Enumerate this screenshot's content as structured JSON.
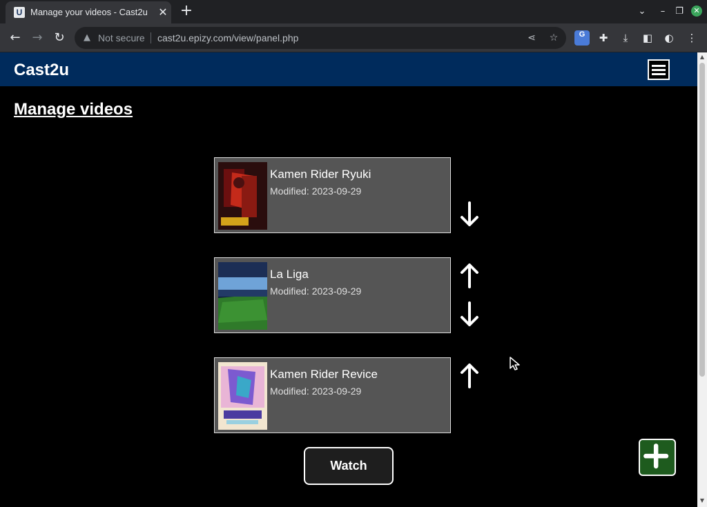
{
  "browser": {
    "tab": {
      "title": "Manage your videos - Cast2u",
      "favicon_letter": "U"
    },
    "new_tab_symbol": "+",
    "omnibox": {
      "security": "Not secure",
      "url": "cast2u.epizy.com/view/panel.php"
    },
    "translate_badge": "G"
  },
  "site": {
    "brand": "Cast2u",
    "page_title": "Manage videos"
  },
  "videos": [
    {
      "title": "Kamen Rider Ryuki",
      "modified": "Modified: 2023-09-29",
      "thumb_colors": [
        "#6b0f0f",
        "#c42a1a",
        "#2a0d0d"
      ]
    },
    {
      "title": "La Liga",
      "modified": "Modified: 2023-09-29",
      "thumb_colors": [
        "#0d1c3a",
        "#2f7a2a",
        "#6fa3d8"
      ]
    },
    {
      "title": "Kamen Rider Revice",
      "modified": "Modified: 2023-09-29",
      "thumb_colors": [
        "#e9b5d6",
        "#7c5ad0",
        "#3aa8c8"
      ]
    }
  ],
  "actions": {
    "watch_label": "Watch",
    "add_icon": "plus-icon"
  },
  "colors": {
    "header_bg": "#002b5c",
    "card_bg": "#555555",
    "add_button": "#1e5b1e"
  }
}
